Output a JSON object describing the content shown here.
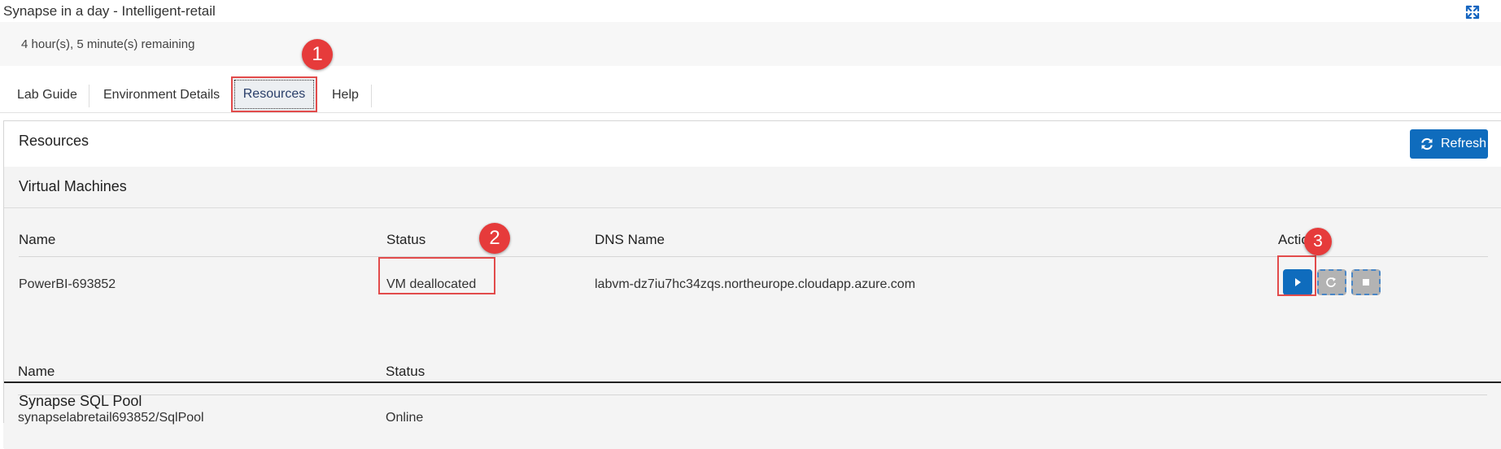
{
  "window": {
    "title": "Synapse in a day - Intelligent-retail",
    "expand_icon": "expand-icon",
    "timer_text": "4 hour(s), 5 minute(s) remaining"
  },
  "tabs": [
    {
      "label": "Lab Guide",
      "active": false
    },
    {
      "label": "Environment Details",
      "active": false
    },
    {
      "label": "Resources",
      "active": true
    },
    {
      "label": "Help",
      "active": false
    }
  ],
  "resources": {
    "title": "Resources",
    "refresh_label": "Refresh",
    "refresh_icon": "refresh-icon",
    "accent": "#0f6cbd"
  },
  "virtual_machines": {
    "title": "Virtual Machines",
    "columns": {
      "name": "Name",
      "status": "Status",
      "dns": "DNS Name",
      "actions": "Actions"
    },
    "rows": [
      {
        "name": "PowerBI-693852",
        "status": "VM deallocated",
        "dns": "labvm-dz7iu7hc34zqs.northeurope.cloudapp.azure.com",
        "actions": [
          "start-icon",
          "restart-icon",
          "stop-icon"
        ]
      }
    ]
  },
  "sql_pool": {
    "title": "Synapse SQL Pool",
    "columns": {
      "name": "Name",
      "status": "Status"
    },
    "rows": [
      {
        "name": "synapselabretail693852/SqlPool",
        "status": "Online"
      }
    ]
  },
  "callouts": [
    "1",
    "2",
    "3"
  ],
  "callout_color": "#e63b3b"
}
